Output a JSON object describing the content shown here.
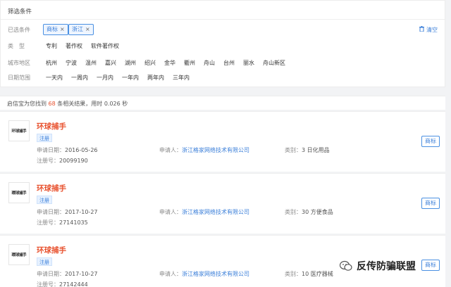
{
  "filter": {
    "title": "筛选条件",
    "selected_label": "已选条件",
    "chips": [
      {
        "label": "商标"
      },
      {
        "label": "浙江"
      }
    ],
    "chip_close": "×",
    "clear_label": "清空",
    "type_label": "类　型",
    "types": [
      "专利",
      "著作权",
      "软件著作权"
    ],
    "city_label": "城市地区",
    "cities": [
      "杭州",
      "宁波",
      "温州",
      "嘉兴",
      "湖州",
      "绍兴",
      "金华",
      "衢州",
      "舟山",
      "台州",
      "丽水",
      "舟山新区"
    ],
    "date_label": "日期范围",
    "dates": [
      "一天内",
      "一周内",
      "一月内",
      "一年内",
      "两年内",
      "三年内"
    ]
  },
  "summary": {
    "prefix": "启信宝为您找到",
    "count": "68",
    "suffix": "条相关结果，用时 0.026 秒"
  },
  "labels": {
    "apply_date": "申请日期：",
    "applicant": "申请人：",
    "category": "类别：",
    "reg_no": "注册号："
  },
  "results": [
    {
      "logo": "环球捕手",
      "name": "环球捕手",
      "status": "注册",
      "apply_date": "2016-05-26",
      "applicant": "浙江格家网络技术有限公司",
      "category": "3 日化用品",
      "reg_no": "20099190",
      "type_button": "商标"
    },
    {
      "logo": "環球捕手",
      "name": "环球捕手",
      "status": "注册",
      "apply_date": "2017-10-27",
      "applicant": "浙江格家网络技术有限公司",
      "category": "30 方便食品",
      "reg_no": "27141035",
      "type_button": "商标"
    },
    {
      "logo": "環球捕手",
      "name": "环球捕手",
      "status": "注册",
      "apply_date": "2017-10-27",
      "applicant": "浙江格家网络技术有限公司",
      "category": "10 医疗器械",
      "reg_no": "27142444",
      "type_button": "商标"
    }
  ],
  "watermark": {
    "text": "反传防骗联盟",
    "icon": "wechat-icon"
  }
}
